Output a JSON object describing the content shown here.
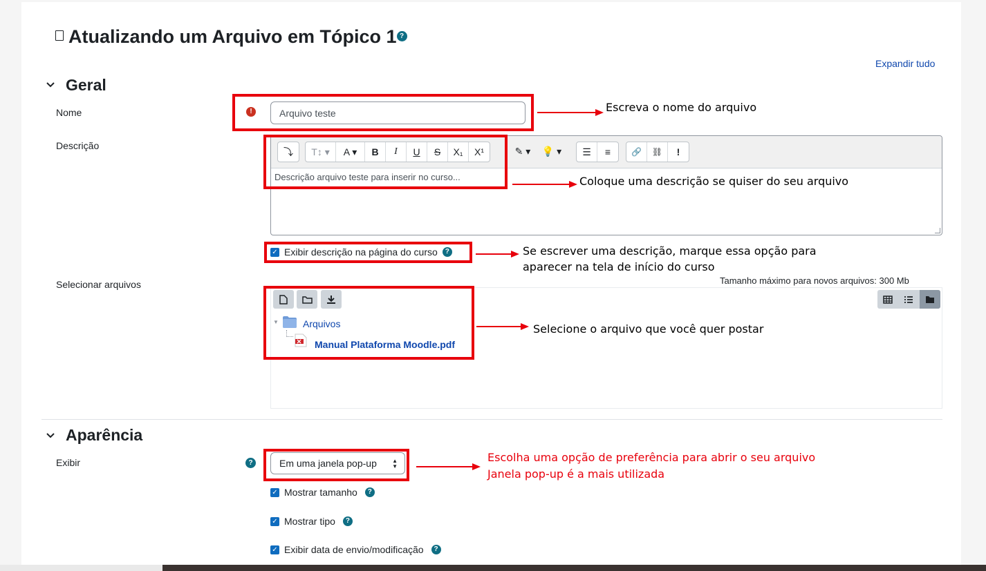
{
  "page": {
    "title": "Atualizando um Arquivo em Tópico 1",
    "help_icon": "?",
    "expand_all": "Expandir tudo"
  },
  "geral": {
    "section_title": "Geral",
    "name_label": "Nome",
    "name_value": "Arquivo teste",
    "required_icon": "!",
    "desc_label": "Descrição",
    "desc_value": "Descrição arquivo teste para inserir no curso...",
    "toolbar": {
      "collapse": "⤵",
      "style": "T↕ ▾",
      "font_color": "A ▾",
      "bold": "B",
      "italic": "I",
      "underline": "U",
      "strike": "S",
      "subscript": "X₁",
      "superscript": "X¹",
      "highlight": "✎ ▾",
      "idea": "💡 ▾",
      "unordered_list": "☰",
      "ordered_list": "≡",
      "link": "🔗",
      "unlink": "⛓",
      "accessibility": "!"
    },
    "show_desc_label": "Exibir descrição na página do curso",
    "files_label": "Selecionar arquivos",
    "max_size": "Tamanho máximo para novos arquivos: 300 Mb",
    "folder_name": "Arquivos",
    "file_name": "Manual Plataforma Moodle.pdf"
  },
  "aparencia": {
    "section_title": "Aparência",
    "display_label": "Exibir",
    "display_value": "Em uma janela pop-up",
    "show_size": "Mostrar tamanho",
    "show_type": "Mostrar tipo",
    "show_date": "Exibir data de envio/modificação"
  },
  "annotations": {
    "name_note": "Escreva o nome do arquivo",
    "desc_note": "Coloque uma descrição se quiser do seu arquivo",
    "check_note_1": "Se escrever uma descrição, marque essa opção para",
    "check_note_2": "aparecer na tela de início do curso",
    "file_note": "Selecione o arquivo que você quer postar",
    "display_note_1": "Escolha uma opção de preferência para abrir o seu arquivo",
    "display_note_2": "Janela pop-up é a mais utilizada"
  },
  "colors": {
    "accent": "#0f6cbf",
    "help": "#0f6e84",
    "annotation_red": "#e8000c",
    "required": "#ca3120"
  }
}
